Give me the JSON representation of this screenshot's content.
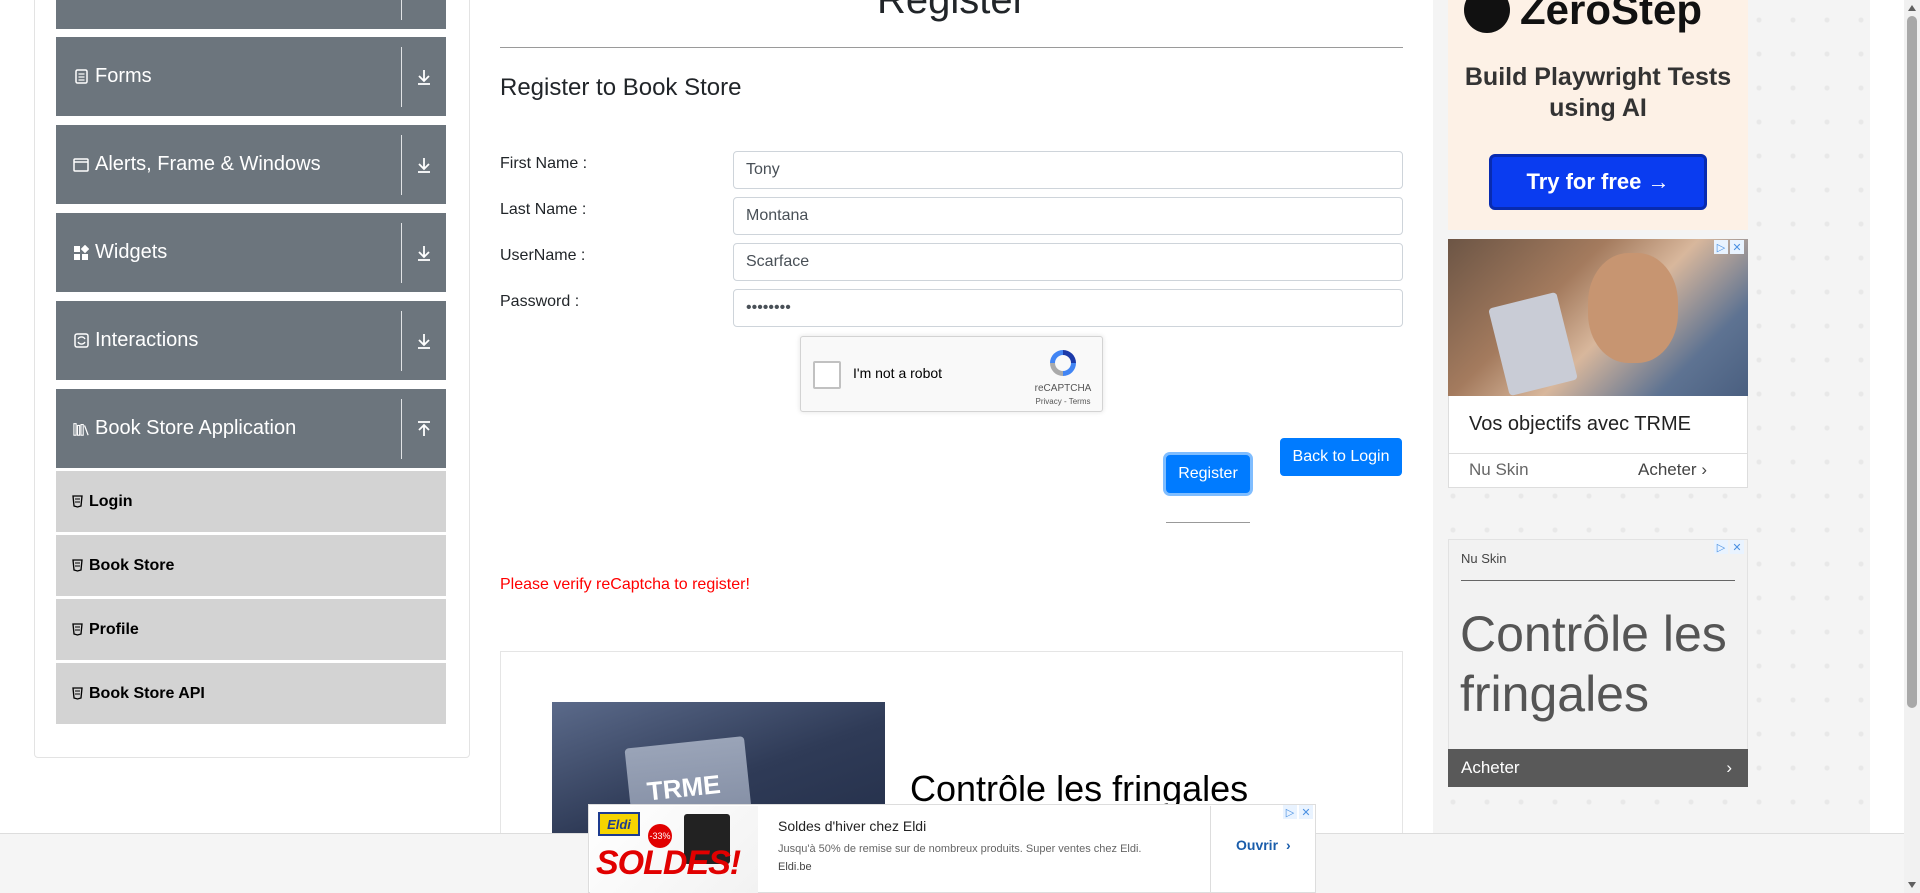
{
  "sidebar": {
    "groups": [
      {
        "label": "Forms",
        "icon": "form-icon",
        "state": "collapsed"
      },
      {
        "label": "Alerts, Frame & Windows",
        "icon": "window-icon",
        "state": "collapsed"
      },
      {
        "label": "Widgets",
        "icon": "widgets-icon",
        "state": "collapsed"
      },
      {
        "label": "Interactions",
        "icon": "interactions-icon",
        "state": "collapsed"
      },
      {
        "label": "Book Store Application",
        "icon": "books-icon",
        "state": "expanded"
      }
    ],
    "items": [
      {
        "label": "Login"
      },
      {
        "label": "Book Store"
      },
      {
        "label": "Profile"
      },
      {
        "label": "Book Store API"
      }
    ]
  },
  "main": {
    "header": "Register",
    "title": "Register to Book Store",
    "fields": [
      {
        "label": "First Name :",
        "value": "Tony"
      },
      {
        "label": "Last Name :",
        "value": "Montana"
      },
      {
        "label": "UserName :",
        "value": "Scarface"
      },
      {
        "label": "Password :",
        "value": "••••••••"
      }
    ],
    "captcha": {
      "label": "I'm not a robot",
      "brand": "reCAPTCHA",
      "links": "Privacy - Terms"
    },
    "register_button": "Register",
    "back_button": "Back to Login",
    "error": "Please verify reCaptcha to register!",
    "inline_ad": {
      "product_text": "TRME",
      "title": "Contrôle les fringales"
    }
  },
  "ads": {
    "zerostep": {
      "logo": "ZeroStep",
      "subtitle": "Build Playwright Tests using AI",
      "button": "Try for free →"
    },
    "trme": {
      "title": "Vos objectifs avec TRME",
      "brand": "Nu Skin",
      "cta": "Acheter"
    },
    "nuskin": {
      "brand": "Nu Skin",
      "title": "Contrôle les fringales",
      "cta": "Acheter"
    },
    "eldi": {
      "logo": "Eldi",
      "headline": "SOLDES!",
      "discount": "-33%",
      "title": "Soldes d'hiver chez Eldi",
      "description": "Jusqu'à 50% de remise sur de nombreux produits. Super ventes chez Eldi.",
      "url": "Eldi.be",
      "cta": "Ouvrir"
    }
  },
  "colors": {
    "sidebar_header": "#6c757d",
    "sidebar_item": "#d3d3d3",
    "primary": "#007bff",
    "error": "#ff0000",
    "zerostep_button": "#0a3cf0"
  }
}
